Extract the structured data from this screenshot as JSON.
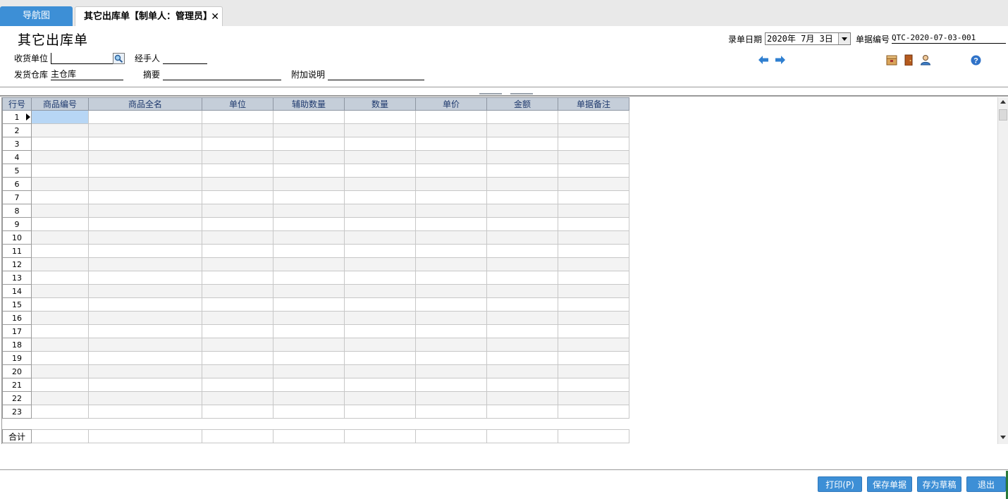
{
  "tabs": {
    "nav": "导航图",
    "doc": "其它出库单【制单人：管理员】",
    "close": "✕"
  },
  "page_title": "其它出库单",
  "form": {
    "receiver_label": "收货单位",
    "receiver_value": "",
    "handler_label": "经手人",
    "handler_value": "",
    "warehouse_label": "发货仓库",
    "warehouse_value": "主仓库",
    "summary_label": "摘要",
    "summary_value": "",
    "extra_label": "附加说明",
    "extra_value": "",
    "date_label": "录单日期",
    "date_value": "2020年 7月 3日",
    "docno_label": "单据编号",
    "docno_value": "QTC-2020-07-03-001"
  },
  "grid": {
    "columns": [
      "行号",
      "商品编号",
      "商品全名",
      "单位",
      "辅助数量",
      "数量",
      "单价",
      "金额",
      "单据备注"
    ],
    "rows": [
      "1",
      "2",
      "3",
      "4",
      "5",
      "6",
      "7",
      "8",
      "9",
      "10",
      "11",
      "12",
      "13",
      "14",
      "15",
      "16",
      "17",
      "18",
      "19",
      "20",
      "21",
      "22",
      "23"
    ],
    "total_label": "合计"
  },
  "buttons": {
    "print": "打印(P)",
    "save": "保存单据",
    "draft": "存为草稿",
    "exit": "退出"
  },
  "colors": {
    "accent": "#3d8fd6",
    "header_bg": "#c5ced9",
    "selected_cell": "#b7d6f5"
  },
  "icons": [
    "search-icon",
    "arrow-left-icon",
    "arrow-right-icon",
    "package-icon",
    "door-icon",
    "user-icon",
    "help-icon"
  ]
}
